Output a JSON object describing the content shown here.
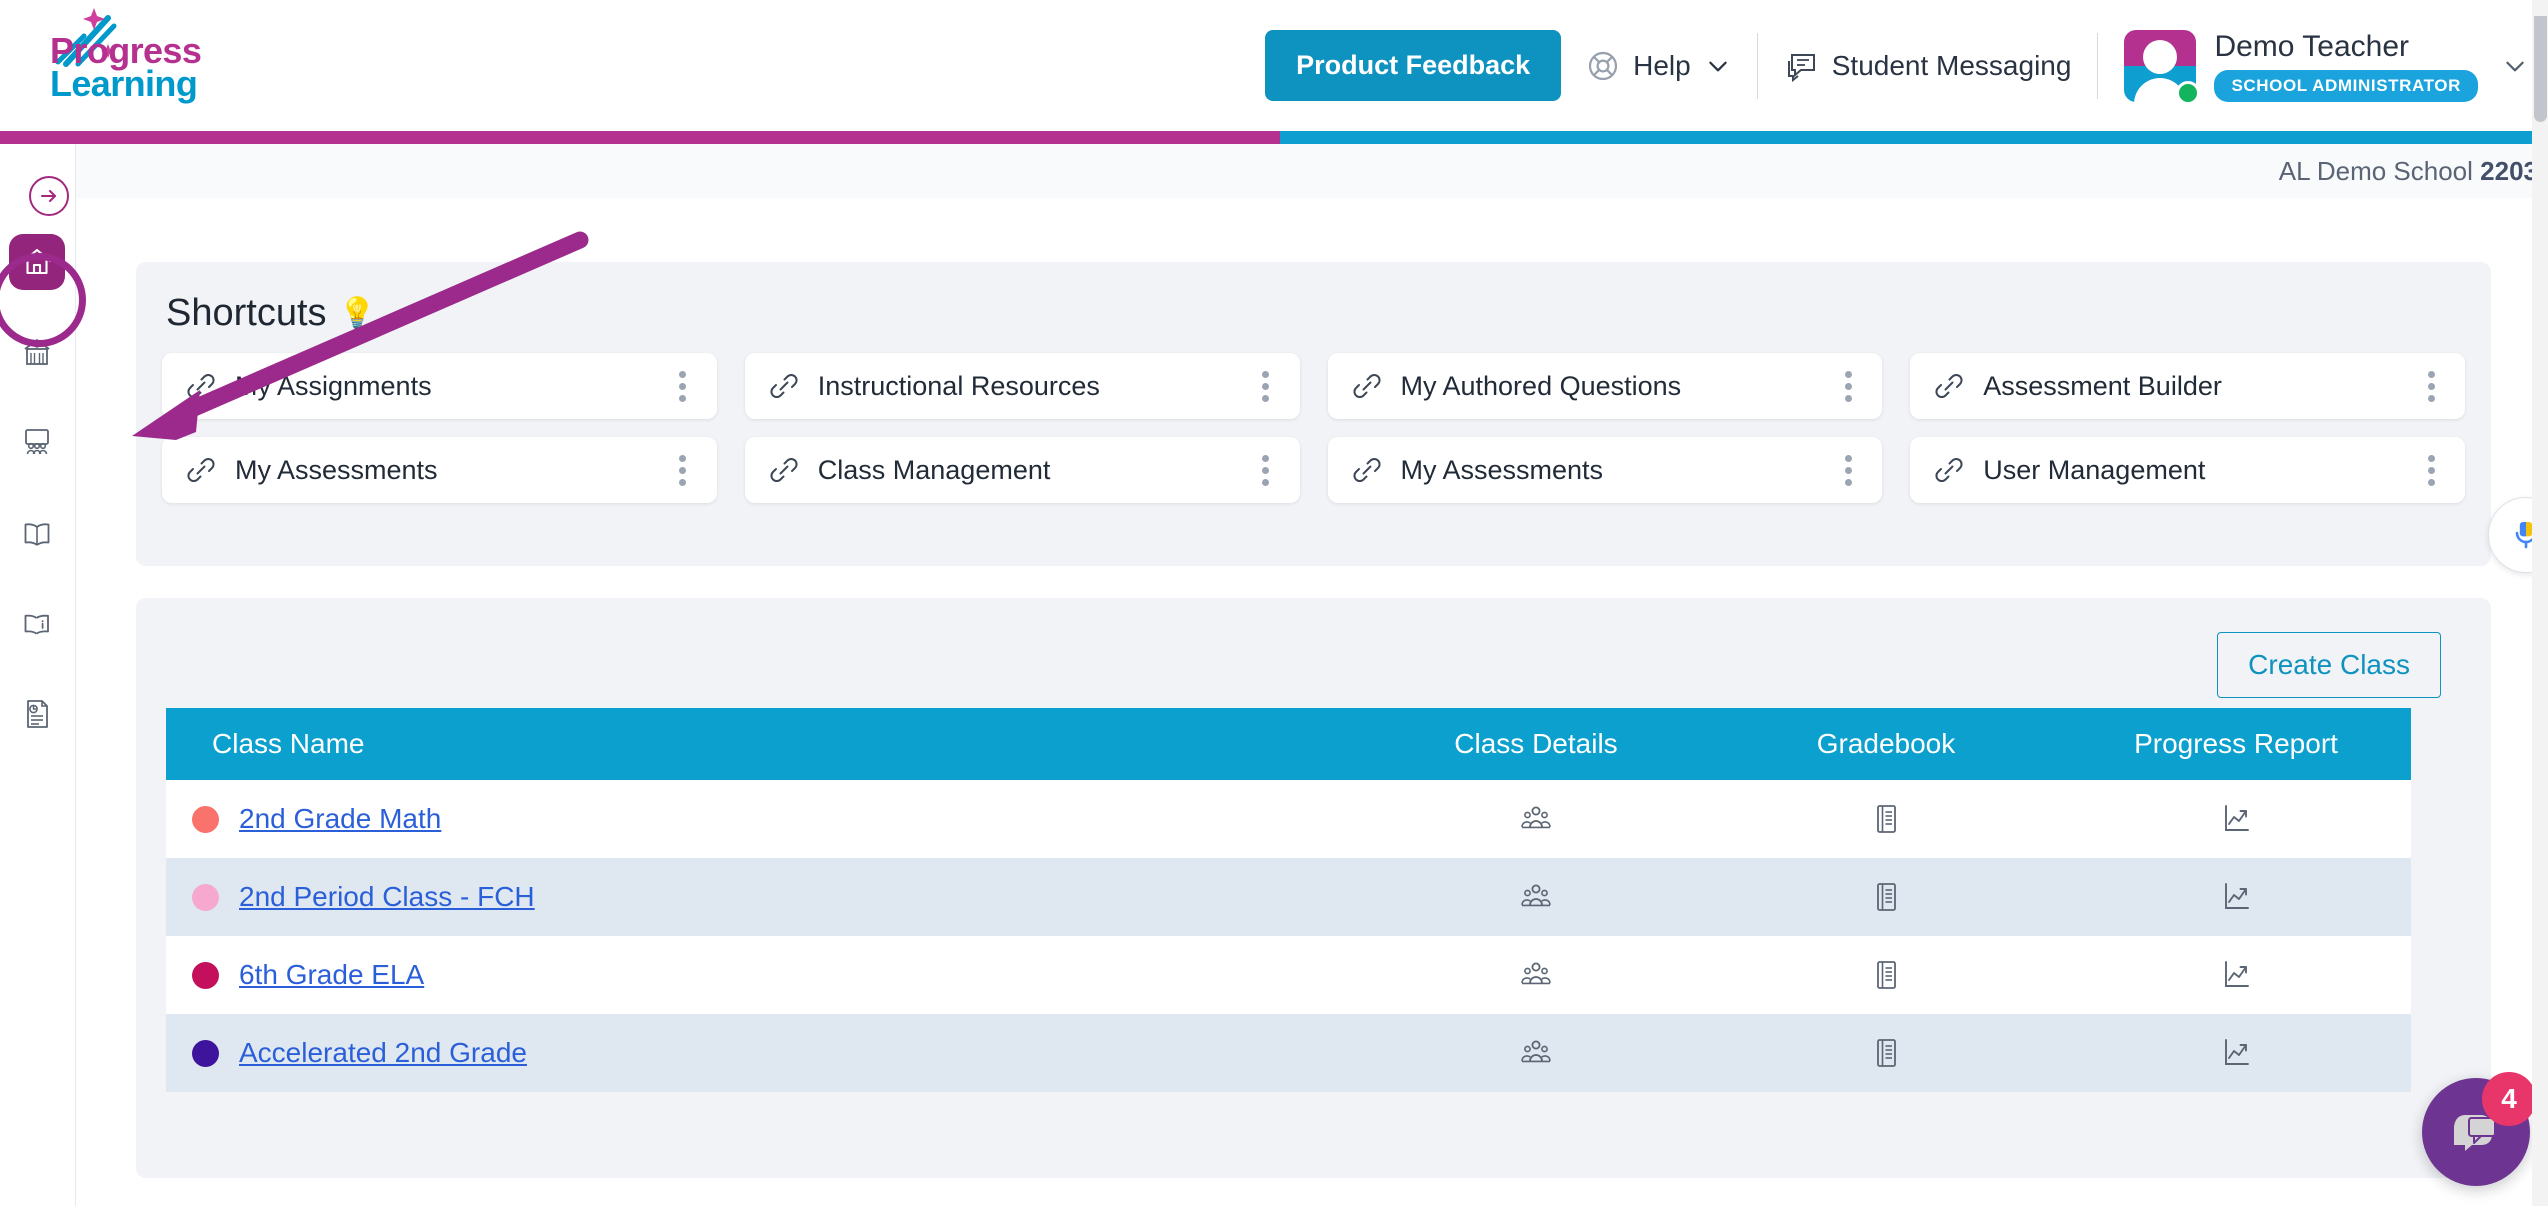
{
  "brand": {
    "logo_line1": "Progress",
    "logo_line2": "Learning",
    "logo_color_1": "#b5318f",
    "logo_color_2": "#0099cc",
    "bar_left_color": "#b5318f",
    "bar_right_color": "#0e9fd0"
  },
  "header": {
    "product_feedback_label": "Product Feedback",
    "help_label": "Help",
    "student_messaging_label": "Student Messaging",
    "user_name": "Demo Teacher",
    "user_role": "SCHOOL ADMINISTRATOR",
    "status_color": "#12b45e"
  },
  "subheader": {
    "school_name": "AL Demo School",
    "school_code": "2203"
  },
  "sidebar": {
    "expand_icon": "arrow-right-circle-icon",
    "items": [
      {
        "name": "home",
        "icon": "home-icon",
        "active": true
      },
      {
        "name": "school",
        "icon": "school-icon",
        "active": false
      },
      {
        "name": "classroom",
        "icon": "classroom-icon",
        "active": false
      },
      {
        "name": "library",
        "icon": "open-book-icon",
        "active": false
      },
      {
        "name": "guide",
        "icon": "book-info-icon",
        "active": false
      },
      {
        "name": "reports",
        "icon": "document-clock-icon",
        "active": false
      }
    ],
    "annotation_color": "#9c2a8c"
  },
  "shortcuts": {
    "title": "Shortcuts",
    "bulb": "💡",
    "items": [
      {
        "label": "My Assignments"
      },
      {
        "label": "Instructional Resources"
      },
      {
        "label": "My Authored Questions"
      },
      {
        "label": "Assessment Builder"
      },
      {
        "label": "My Assessments"
      },
      {
        "label": "Class Management"
      },
      {
        "label": "My Assessments"
      },
      {
        "label": "User Management"
      }
    ]
  },
  "classes": {
    "create_label": "Create Class",
    "columns": [
      "Class Name",
      "Class Details",
      "Gradebook",
      "Progress Report"
    ],
    "rows": [
      {
        "name": "2nd Grade Math",
        "color": "#f9726b"
      },
      {
        "name": "2nd Period Class - FCH",
        "color": "#f7a8ce"
      },
      {
        "name": "6th Grade ELA",
        "color": "#c4105c"
      },
      {
        "name": "Accelerated 2nd Grade",
        "color": "#3d149b"
      }
    ]
  },
  "widgets": {
    "chat_badge_count": "4",
    "chat_icon": "chat-head-icon",
    "mic_icon": "microphone-icon"
  }
}
